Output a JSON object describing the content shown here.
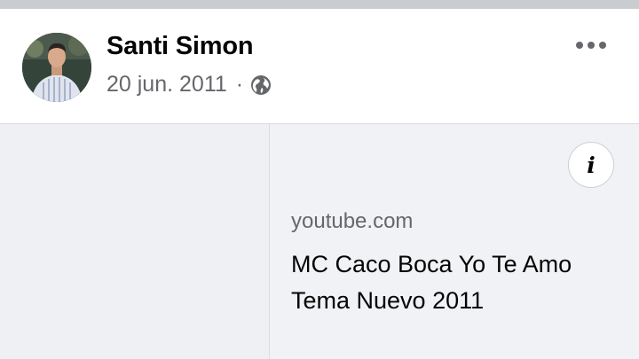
{
  "post": {
    "author": "Santi Simon",
    "date": "20 jun. 2011",
    "separator": "·",
    "privacy_icon": "globe-icon",
    "more_icon": "more-horizontal-icon"
  },
  "link_preview": {
    "domain": "youtube.com",
    "title": "MC Caco Boca Yo Te Amo Tema Nuevo 2011",
    "info_icon": "info-icon",
    "info_glyph": "i"
  },
  "colors": {
    "top_strip": "#c9ccd1",
    "card_background": "#f0f2f5",
    "secondary_text": "#65676b",
    "primary_text": "#050505"
  }
}
